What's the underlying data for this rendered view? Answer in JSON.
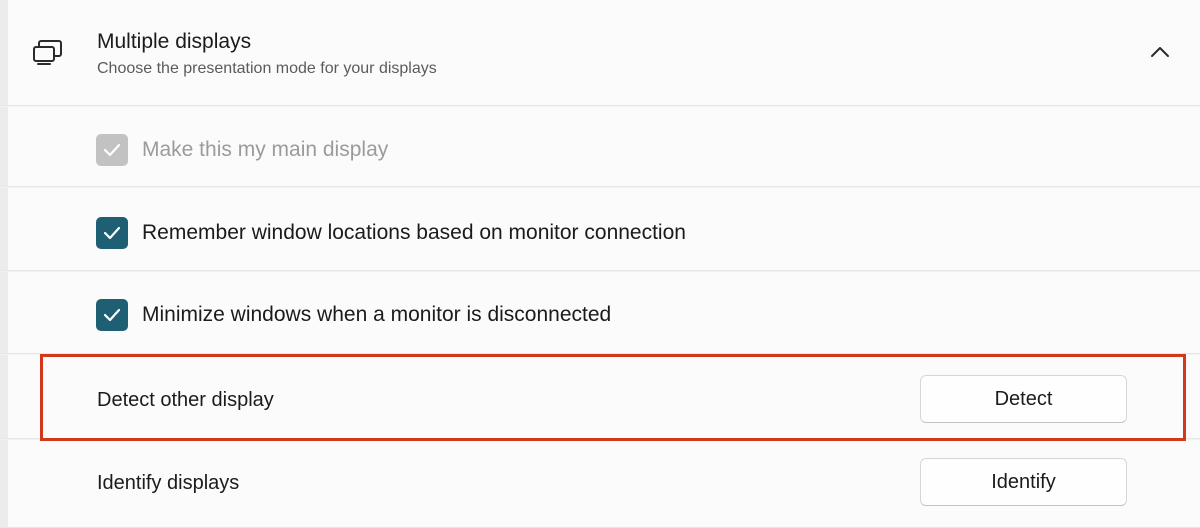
{
  "section": {
    "icon": "multiple-displays-icon",
    "title": "Multiple displays",
    "subtitle": "Choose the presentation mode for your displays",
    "chevron_icon": "chevron-up-icon"
  },
  "options": [
    {
      "label": "Make this my main display",
      "checked": true,
      "disabled": true
    },
    {
      "label": "Remember window locations based on monitor connection",
      "checked": true,
      "disabled": false
    },
    {
      "label": "Minimize windows when a monitor is disconnected",
      "checked": true,
      "disabled": false
    }
  ],
  "actions": [
    {
      "label": "Detect other display",
      "button_label": "Detect",
      "highlighted": true
    },
    {
      "label": "Identify displays",
      "button_label": "Identify",
      "highlighted": false
    }
  ],
  "colors": {
    "accent": "#1f5f73",
    "highlight": "#d2381c",
    "disabled_check": "#c2c2c2"
  }
}
